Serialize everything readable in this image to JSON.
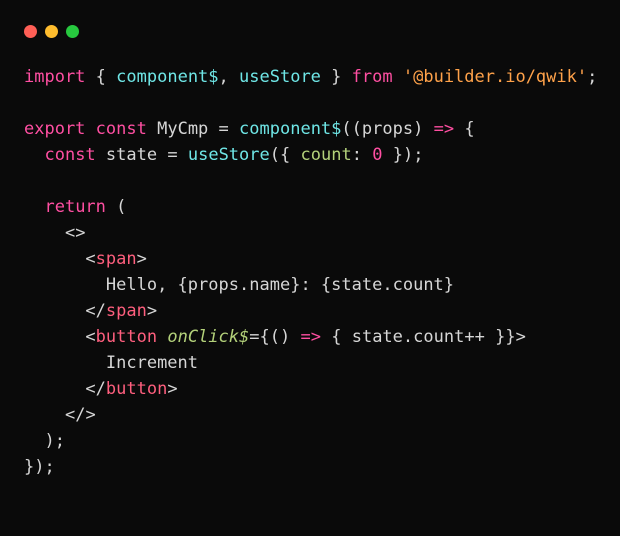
{
  "kw_import": "import",
  "kw_from": "from",
  "kw_export": "export",
  "kw_const": "const",
  "kw_return": "return",
  "fn_component": "component$",
  "fn_useStore": "useStore",
  "str_pkg": "'@builder.io/qwik'",
  "id_MyCmp": "MyCmp",
  "id_props": "props",
  "id_state": "state",
  "id_name": "name",
  "id_count": "count",
  "prop_count_key": "count",
  "num_zero": "0",
  "tag_span": "span",
  "tag_button": "button",
  "attr_onClick": "onClick$",
  "txt_hello": "Hello, ",
  "txt_colon_sp": ": ",
  "txt_increment": "Increment",
  "p_obrace": "{",
  "p_cbrace": "}",
  "p_oparen": "(",
  "p_cparen": ")",
  "p_lt": "<",
  "p_gt": ">",
  "p_slash": "/",
  "p_semi": ";",
  "p_comma": ",",
  "p_eq": "=",
  "p_dot": ".",
  "p_colon": ":",
  "p_sp": " ",
  "p_arrow": "=>",
  "p_plusplus": "++"
}
